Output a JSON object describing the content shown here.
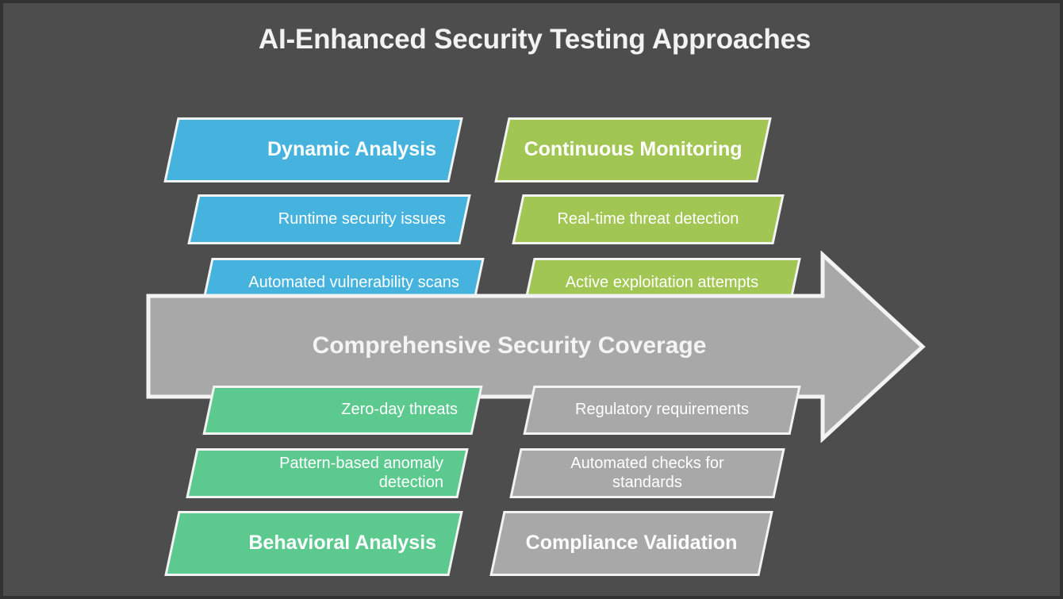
{
  "page": {
    "title": "AI-Enhanced Security Testing Approaches",
    "background_color": "#4d4d4d",
    "border_color": "#323232"
  },
  "center_arrow": {
    "label": "Comprehensive Security Coverage",
    "fill_color": "#a8a8a8",
    "stroke_color": "#f3f3f3",
    "direction": "right"
  },
  "quadrants": {
    "top_left": {
      "color": "#45b3dd",
      "text_align": "right",
      "heading": "Dynamic Analysis",
      "items": [
        "Runtime security issues",
        "Automated vulnerability scans"
      ]
    },
    "top_right": {
      "color": "#a2c653",
      "text_align": "center",
      "heading": "Continuous Monitoring",
      "items": [
        "Real-time threat detection",
        "Active exploitation attempts"
      ]
    },
    "bottom_left": {
      "color": "#5cc98f",
      "text_align": "right",
      "heading": "Behavioral Analysis",
      "items": [
        "Zero-day threats",
        "Pattern-based anomaly detection"
      ]
    },
    "bottom_right": {
      "color": "#a8a8a8",
      "text_align": "center",
      "heading": "Compliance Validation",
      "items": [
        "Regulatory requirements",
        "Automated checks for standards"
      ]
    }
  }
}
